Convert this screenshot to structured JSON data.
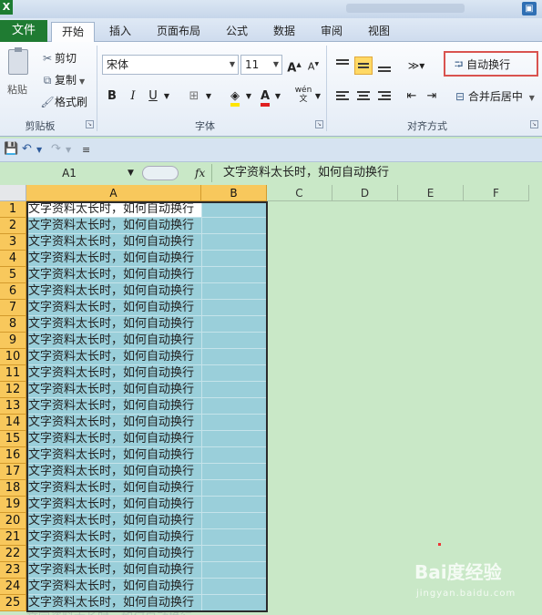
{
  "app": {
    "icon_letter": "X"
  },
  "tabs": {
    "file": "文件",
    "items": [
      {
        "label": "开始",
        "active": true
      },
      {
        "label": "插入",
        "active": false
      },
      {
        "label": "页面布局",
        "active": false
      },
      {
        "label": "公式",
        "active": false
      },
      {
        "label": "数据",
        "active": false
      },
      {
        "label": "审阅",
        "active": false
      },
      {
        "label": "视图",
        "active": false
      }
    ]
  },
  "ribbon": {
    "clipboard": {
      "paste": "粘贴",
      "cut": "剪切",
      "copy": "复制",
      "format_painter": "格式刷",
      "group_label": "剪贴板"
    },
    "font": {
      "font_name": "宋体",
      "font_size": "11",
      "bold": "B",
      "italic": "I",
      "underline": "U",
      "group_label": "字体"
    },
    "alignment": {
      "wrap_text": "自动换行",
      "merge_center": "合并后居中",
      "group_label": "对齐方式"
    }
  },
  "formula_bar": {
    "name_box": "A1",
    "fx": "fx",
    "content": "文字资料太长时，如何自动换行"
  },
  "grid": {
    "columns": [
      "A",
      "B",
      "C",
      "D",
      "E",
      "F"
    ],
    "selected_columns": [
      "A",
      "B"
    ],
    "rows": [
      {
        "n": "1",
        "a": "文字资料太长时，如何自动换行"
      },
      {
        "n": "2",
        "a": "文字资料太长时，如何自动换行"
      },
      {
        "n": "3",
        "a": "文字资料太长时，如何自动换行"
      },
      {
        "n": "4",
        "a": "文字资料太长时，如何自动换行"
      },
      {
        "n": "5",
        "a": "文字资料太长时，如何自动换行"
      },
      {
        "n": "6",
        "a": "文字资料太长时，如何自动换行"
      },
      {
        "n": "7",
        "a": "文字资料太长时，如何自动换行"
      },
      {
        "n": "8",
        "a": "文字资料太长时，如何自动换行"
      },
      {
        "n": "9",
        "a": "文字资料太长时，如何自动换行"
      },
      {
        "n": "10",
        "a": "文字资料太长时，如何自动换行"
      },
      {
        "n": "11",
        "a": "文字资料太长时，如何自动换行"
      },
      {
        "n": "12",
        "a": "文字资料太长时，如何自动换行"
      },
      {
        "n": "13",
        "a": "文字资料太长时，如何自动换行"
      },
      {
        "n": "14",
        "a": "文字资料太长时，如何自动换行"
      },
      {
        "n": "15",
        "a": "文字资料太长时，如何自动换行"
      },
      {
        "n": "16",
        "a": "文字资料太长时，如何自动换行"
      },
      {
        "n": "17",
        "a": "文字资料太长时，如何自动换行"
      },
      {
        "n": "18",
        "a": "文字资料太长时，如何自动换行"
      },
      {
        "n": "19",
        "a": "文字资料太长时，如何自动换行"
      },
      {
        "n": "20",
        "a": "文字资料太长时，如何自动换行"
      },
      {
        "n": "21",
        "a": "文字资料太长时，如何自动换行"
      },
      {
        "n": "22",
        "a": "文字资料太长时，如何自动换行"
      },
      {
        "n": "23",
        "a": "文字资料太长时，如何自动换行"
      },
      {
        "n": "24",
        "a": "文字资料太长时，如何自动换行"
      },
      {
        "n": "25",
        "a": "文字资料太长时，如何自动换行"
      }
    ]
  },
  "watermark": {
    "brand": "Bai度经验",
    "url": "jingyan.baidu.com"
  },
  "colors": {
    "sheet_bg": "#c9e8c7",
    "selection_fill": "#9acfda",
    "header_sel": "#f8c85c",
    "file_tab": "#1f7b32",
    "highlight_box": "#d9534f"
  }
}
